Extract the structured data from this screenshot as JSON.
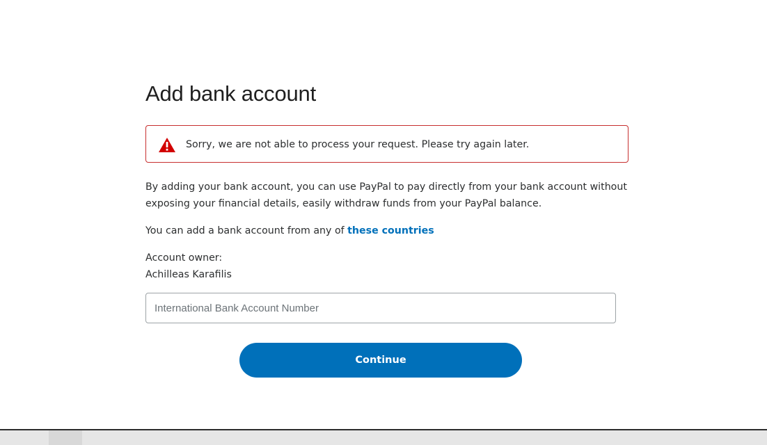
{
  "page": {
    "title": "Add bank account"
  },
  "alert": {
    "icon": "warning-triangle-icon",
    "message": "Sorry, we are not able to process your request. Please try again later.",
    "color": "#c72e2e"
  },
  "description": "By adding your bank account, you can use PayPal to pay directly from your bank account without exposing your financial details, easily withdraw funds from your PayPal balance.",
  "countries": {
    "prefix": "You can add a bank account from any of ",
    "link_label": "these countries"
  },
  "owner": {
    "label": "Account owner:",
    "name": "Achilleas Karafilis"
  },
  "iban": {
    "placeholder": "International Bank Account Number",
    "value": ""
  },
  "continue_button": {
    "label": "Continue",
    "color": "#0070ba"
  }
}
